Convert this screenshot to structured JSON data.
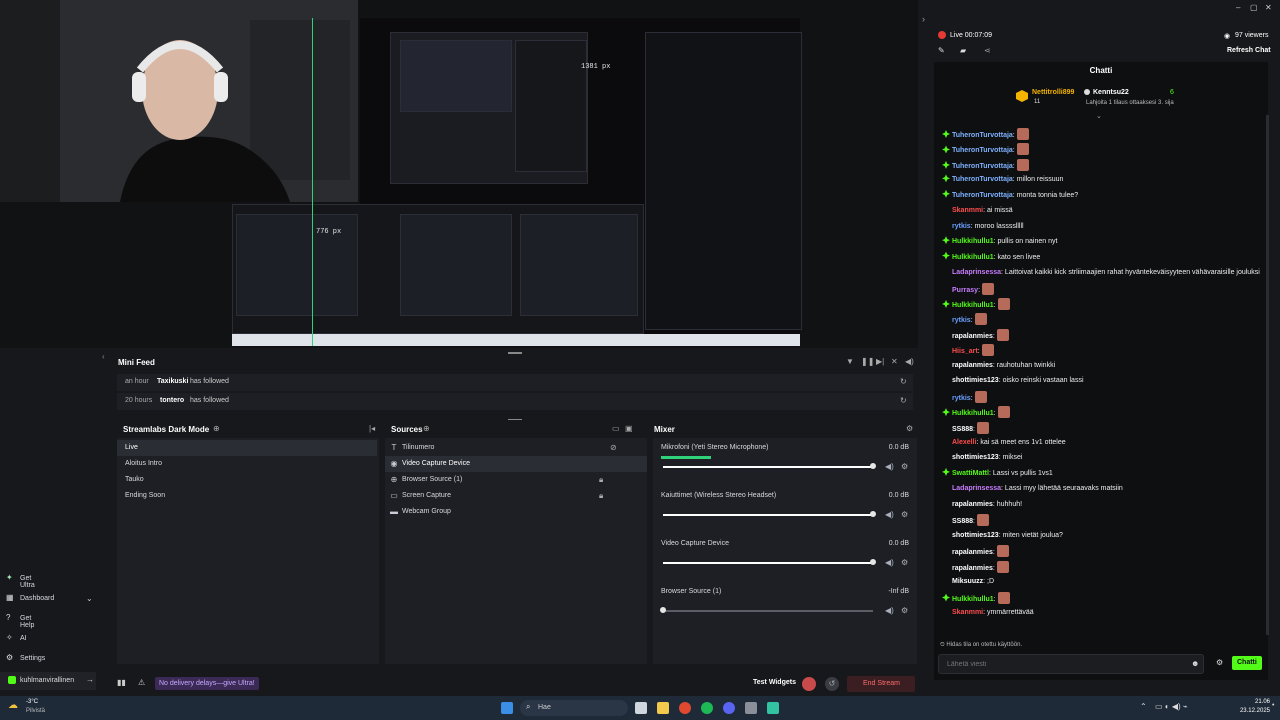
{
  "preview": {
    "width_label": "1381 px",
    "height_label": "776 px"
  },
  "top_right": {
    "live_timer": "Live 00:07:09",
    "viewers": "97 viewers",
    "refresh_chat": "Refresh Chat"
  },
  "mini_feed": {
    "title": "Mini Feed",
    "events": [
      {
        "time": "an hour",
        "user": "Taxikuski",
        "action": "has followed"
      },
      {
        "time": "20 hours",
        "user": "tontero",
        "action": "has followed"
      }
    ]
  },
  "scenes": {
    "title": "Streamlabs Dark Mode",
    "items": [
      "Live",
      "Aloitus Intro",
      "Tauko",
      "Ending Soon"
    ],
    "selected": "Live"
  },
  "sources": {
    "title": "Sources",
    "items": [
      {
        "label": "Tilinumero",
        "icon": "text-icon"
      },
      {
        "label": "Video Capture Device",
        "icon": "camera-icon"
      },
      {
        "label": "Browser Source (1)",
        "icon": "globe-icon"
      },
      {
        "label": "Screen Capture",
        "icon": "monitor-icon"
      },
      {
        "label": "Webcam Group",
        "icon": "folder-icon"
      }
    ],
    "selected": "Video Capture Device"
  },
  "mixer": {
    "title": "Mixer",
    "channels": [
      {
        "name": "Mikrofoni (Yeti Stereo Microphone)",
        "db": "0.0 dB",
        "level": 1.0
      },
      {
        "name": "Kaiuttimet (Wireless Stereo Headset)",
        "db": "0.0 dB",
        "level": 1.0
      },
      {
        "name": "Video Capture Device",
        "db": "0.0 dB",
        "level": 1.0
      },
      {
        "name": "Browser Source (1)",
        "db": "-Inf dB",
        "level": 0.0
      }
    ]
  },
  "sidebar": {
    "items": [
      {
        "label": "Get Ultra",
        "icon": "ultra-icon"
      },
      {
        "label": "Dashboard",
        "icon": "dashboard-icon"
      },
      {
        "label": "Get Help",
        "icon": "help-icon"
      },
      {
        "label": "AI",
        "icon": "ai-icon"
      },
      {
        "label": "Settings",
        "icon": "gear-icon"
      }
    ],
    "profile": "kuhlmanvirallinen"
  },
  "bottom_bar": {
    "promo": "No delivery delays—give Ultra!",
    "test_widgets": "Test Widgets",
    "end_stream": "End Stream"
  },
  "chat": {
    "title": "Chatti",
    "top_gifter": {
      "name": "Nettitrolli899",
      "count": "11",
      "second": "Kenntsu22",
      "second_count": "6"
    },
    "gift_note": "Lahjoita 1 tilaus ottaaksesi 3. sija",
    "messages": [
      {
        "user": "TuheronTurvottaja",
        "color": "#7fb2ff",
        "text": ""
      },
      {
        "user": "TuheronTurvottaja",
        "color": "#7fb2ff",
        "text": ""
      },
      {
        "user": "TuheronTurvottaja",
        "color": "#7fb2ff",
        "text": ""
      },
      {
        "user": "TuheronTurvottaja",
        "color": "#7fb2ff",
        "text": "millon reissuun"
      },
      {
        "user": "TuheronTurvottaja",
        "color": "#7fb2ff",
        "text": "monta tonnia tulee?"
      },
      {
        "user": "Skanmmi",
        "color": "#ff4d4d",
        "text": "ai missä"
      },
      {
        "user": "rytkis",
        "color": "#6aa0ff",
        "text": "moroo lasssslllll"
      },
      {
        "user": "Hulkkihullu1",
        "color": "#53fc18",
        "text": "pullis on nainen nyt"
      },
      {
        "user": "Hulkkihullu1",
        "color": "#53fc18",
        "text": "kato sen livee"
      },
      {
        "user": "Ladaprinsessa",
        "color": "#c77dff",
        "text": "Laittoivat kaikki kick strliimaajien rahat hyväntekeväisyyteen vähävaraisille jouluksi"
      },
      {
        "user": "Purrasy",
        "color": "#c77dff",
        "text": ""
      },
      {
        "user": "Hulkkihullu1",
        "color": "#53fc18",
        "text": ""
      },
      {
        "user": "rytkis",
        "color": "#6aa0ff",
        "text": ""
      },
      {
        "user": "rapalanmies",
        "color": "#ffffff",
        "text": ""
      },
      {
        "user": "Hiis_art",
        "color": "#ff4d4d",
        "text": ""
      },
      {
        "user": "rapalanmies",
        "color": "#ffffff",
        "text": "rauhotuhan twinkki"
      },
      {
        "user": "shottimies123",
        "color": "#ffffff",
        "text": "oisko reinski vastaan lassi"
      },
      {
        "user": "rytkis",
        "color": "#6aa0ff",
        "text": ""
      },
      {
        "user": "Hulkkihullu1",
        "color": "#53fc18",
        "text": ""
      },
      {
        "user": "SS888",
        "color": "#ffffff",
        "text": ""
      },
      {
        "user": "Alexelli",
        "color": "#ff4d4d",
        "text": "kai sä meet ens 1v1 ottelee"
      },
      {
        "user": "shottimies123",
        "color": "#ffffff",
        "text": "miksei"
      },
      {
        "user": "SwattiMattl",
        "color": "#53fc18",
        "text": "Lassi vs pullis 1vs1"
      },
      {
        "user": "Ladaprinsessa",
        "color": "#c77dff",
        "text": "Lassi myy lähetää seuraavaks matsiin"
      },
      {
        "user": "rapalanmies",
        "color": "#ffffff",
        "text": "huhhuh!"
      },
      {
        "user": "SS888",
        "color": "#ffffff",
        "text": ""
      },
      {
        "user": "shottimies123",
        "color": "#ffffff",
        "text": "miten vietät joulua?"
      },
      {
        "user": "rapalanmies",
        "color": "#ffffff",
        "text": ""
      },
      {
        "user": "rapalanmies",
        "color": "#ffffff",
        "text": ""
      },
      {
        "user": "Miksuuzz",
        "color": "#ffffff",
        "text": ";D"
      },
      {
        "user": "Hulkkihullu1",
        "color": "#53fc18",
        "text": ""
      },
      {
        "user": "Skanmmi",
        "color": "#ff4d4d",
        "text": "ymmärrettävää"
      }
    ],
    "slow_mode": "Hidas tila on otettu käyttöön.",
    "input_placeholder": "Lähetä viesti",
    "send_label": "Chatti"
  },
  "taskbar": {
    "weather_temp": "-3°C",
    "weather_desc": "Pilvistä",
    "search_placeholder": "Hae",
    "time": "21.06",
    "date": "23.12.2025"
  }
}
